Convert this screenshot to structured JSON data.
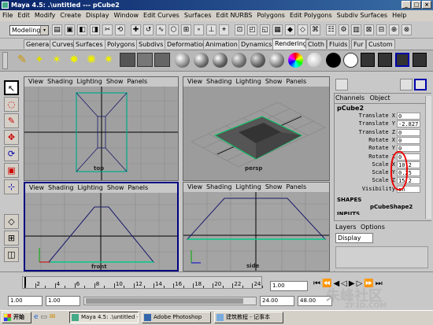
{
  "window": {
    "title": "Maya 4.5: .\\untitled  ---  pCube2",
    "min": "_",
    "max": "□",
    "close": "×"
  },
  "menu": [
    "File",
    "Edit",
    "Modify",
    "Create",
    "Display",
    "Window",
    "Edit Curves",
    "Surfaces",
    "Edit NURBS",
    "Polygons",
    "Edit Polygons",
    "Subdiv Surfaces",
    "Help"
  ],
  "mode_selector": {
    "value": "Modeling",
    "arrow": "▾"
  },
  "status_icons": [
    "▤",
    "▣",
    "◧",
    "◨",
    "✂",
    "⟲",
    "✚",
    "↺",
    "∿",
    "⬡",
    "⊞",
    "∘",
    "⊥",
    "⌖",
    "⊡",
    "◰",
    "◱",
    "▦",
    "◆",
    "◇",
    "⌘",
    "☷",
    "⚙",
    "▥",
    "⊠",
    "⊟",
    "⊕",
    "⊗"
  ],
  "shelf_tabs": [
    "General",
    "Curves",
    "Surfaces",
    "Polygons",
    "Subdivs",
    "Deformation",
    "Animation",
    "Dynamics",
    "Rendering",
    "Cloth",
    "Fluids",
    "Fur",
    "Custom"
  ],
  "shelf_active": "Rendering",
  "shelf_icons": [
    "✎",
    "✦",
    "✶",
    "✸",
    "✺",
    "✷"
  ],
  "viewports": [
    {
      "menu": [
        "View",
        "Shading",
        "Lighting",
        "Show",
        "Panels"
      ],
      "camera": "top"
    },
    {
      "menu": [
        "View",
        "Shading",
        "Lighting",
        "Show",
        "Panels"
      ],
      "camera": "persp"
    },
    {
      "menu": [
        "View",
        "Shading",
        "Lighting",
        "Show",
        "Panels"
      ],
      "camera": "front"
    },
    {
      "menu": [
        "View",
        "Shading",
        "Lighting",
        "Show",
        "Panels"
      ],
      "camera": "side"
    }
  ],
  "channel_box": {
    "tabs": [
      "Channels",
      "Object"
    ],
    "object": "pCube2",
    "rows": [
      {
        "label": "Translate X",
        "value": "0"
      },
      {
        "label": "Translate Y",
        "value": "-2.827"
      },
      {
        "label": "Translate Z",
        "value": "0"
      },
      {
        "label": "Rotate X",
        "value": "0"
      },
      {
        "label": "Rotate Y",
        "value": "0"
      },
      {
        "label": "Rotate Z",
        "value": "0"
      },
      {
        "label": "Scale X",
        "value": "10.2"
      },
      {
        "label": "Scale Y",
        "value": "0.25"
      },
      {
        "label": "Scale Z",
        "value": "15.2"
      },
      {
        "label": "Visibility",
        "value": "on"
      }
    ],
    "shapes_header": "SHAPES",
    "shape": "pCubeShape2",
    "inputs_header": "INPUTS"
  },
  "layers": {
    "tabs": [
      "Layers",
      "Options"
    ],
    "display": "Display"
  },
  "timeline": {
    "ticks": [
      "2",
      "4",
      "6",
      "8",
      "10",
      "12",
      "14",
      "16",
      "18",
      "20",
      "22",
      "24"
    ],
    "current": "1.00"
  },
  "range": {
    "start": "1.00",
    "anim_start": "1.00",
    "end": "24.00",
    "anim_end": "48.00"
  },
  "taskbar": {
    "start": "开始",
    "tasks": [
      "Maya 4.5: .\\untitled ---",
      "Adobe Photoshop",
      "建筑教程 - 记事本"
    ]
  },
  "watermark": {
    "line1": "朱峰社区",
    "line2": "ZF3D.COM"
  }
}
